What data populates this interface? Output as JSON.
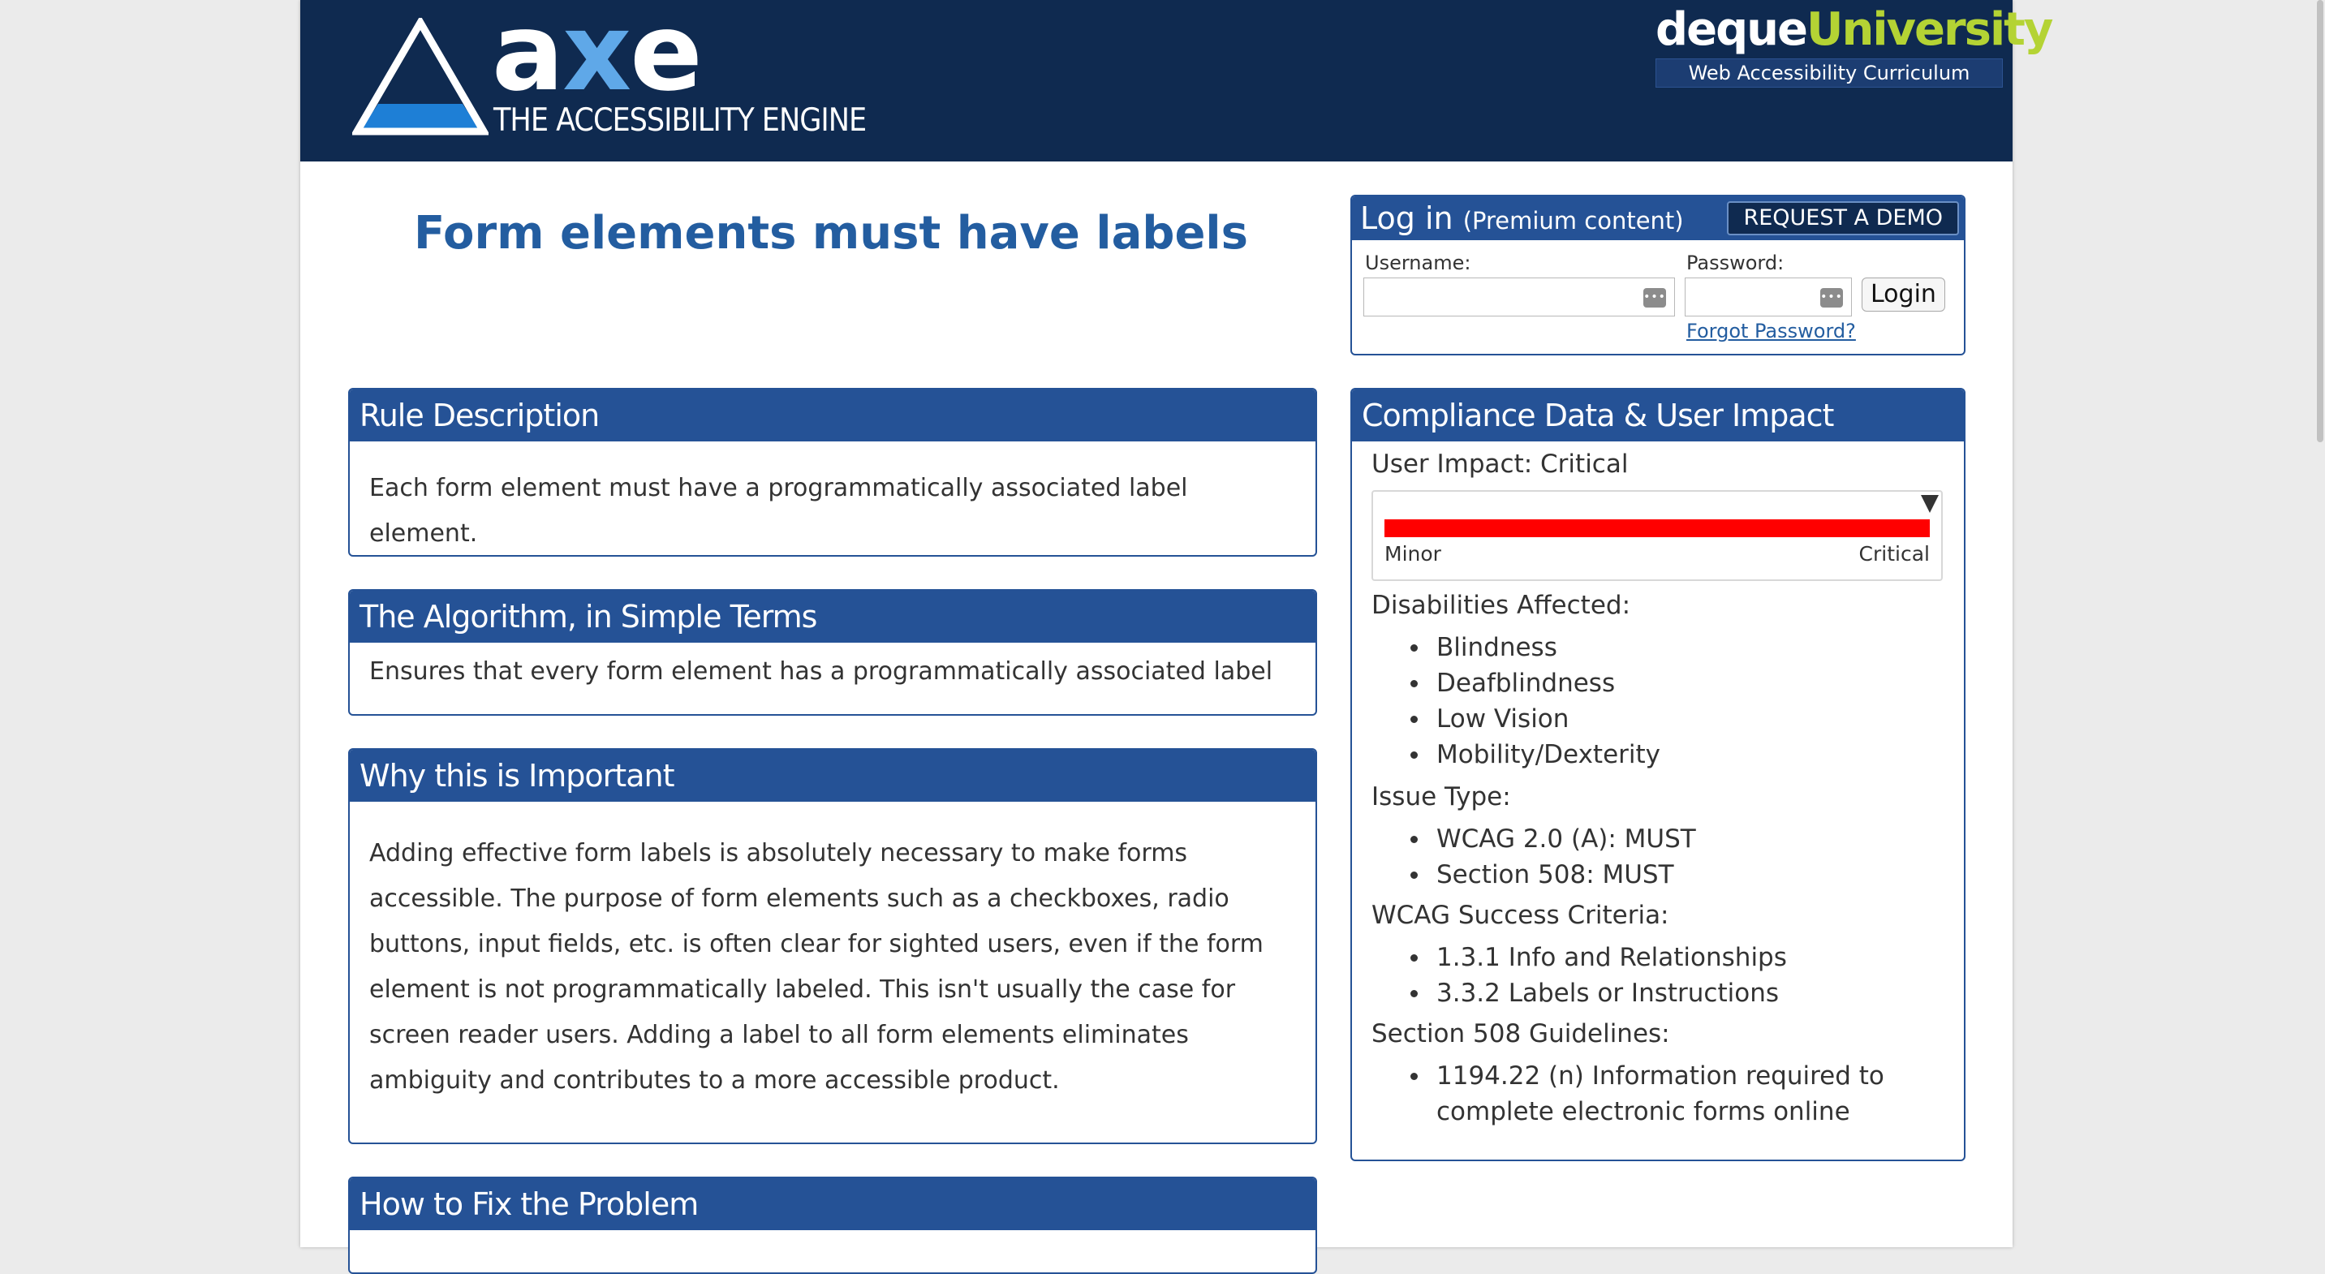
{
  "header": {
    "logo_word_a": "a",
    "logo_word_x": "x",
    "logo_word_e": "e",
    "logo_tagline": "THE ACCESSIBILITY ENGINE",
    "brand_prefix": "deque",
    "brand_suffix": "University",
    "brand_tagline": "Web Accessibility Curriculum"
  },
  "title": "Form elements must have labels",
  "login": {
    "heading": "Log in",
    "heading_note": "(Premium content)",
    "demo_label": "REQUEST A DEMO",
    "username_label": "Username:",
    "password_label": "Password:",
    "login_button": "Login",
    "forgot_link": "Forgot Password?",
    "key_icon": "password-manager-icon"
  },
  "panels": {
    "rule": {
      "title": "Rule Description",
      "body": "Each form element must have a programmatically associated label element."
    },
    "algorithm": {
      "title": "The Algorithm, in Simple Terms",
      "body": "Ensures that every form element has a programmatically associated label"
    },
    "important": {
      "title": "Why this is Important",
      "body": "Adding effective form labels is absolutely necessary to make forms accessible. The purpose of form elements such as a checkboxes, radio buttons, input fields, etc. is often clear for sighted users, even if the form element is not programmatically labeled. This isn't usually the case for screen reader users. Adding a label to all form elements eliminates ambiguity and contributes to a more accessible product."
    },
    "fix": {
      "title": "How to Fix the Problem"
    }
  },
  "compliance": {
    "title": "Compliance Data & User Impact",
    "impact_label": "User Impact:",
    "impact_value": "Critical",
    "impact_level": 1.0,
    "scale_min": "Minor",
    "scale_max": "Critical",
    "bar_color": "#ff0000",
    "disabilities_heading": "Disabilities Affected:",
    "disabilities": [
      "Blindness",
      "Deafblindness",
      "Low Vision",
      "Mobility/Dexterity"
    ],
    "issue_heading": "Issue Type:",
    "issue_types": [
      "WCAG 2.0 (A): MUST",
      "Section 508: MUST"
    ],
    "wcag_heading": "WCAG Success Criteria:",
    "wcag": [
      "1.3.1 Info and Relationships",
      "3.3.2 Labels or Instructions"
    ],
    "s508_heading": "Section 508 Guidelines:",
    "s508_line1": "1194.22 (n) Information required to",
    "s508_line2": "complete electronic forms online"
  },
  "colors": {
    "header_bg": "#0f2a50",
    "panel_blue": "#255296",
    "title_blue": "#235da0",
    "brand_green": "#b4d334"
  }
}
